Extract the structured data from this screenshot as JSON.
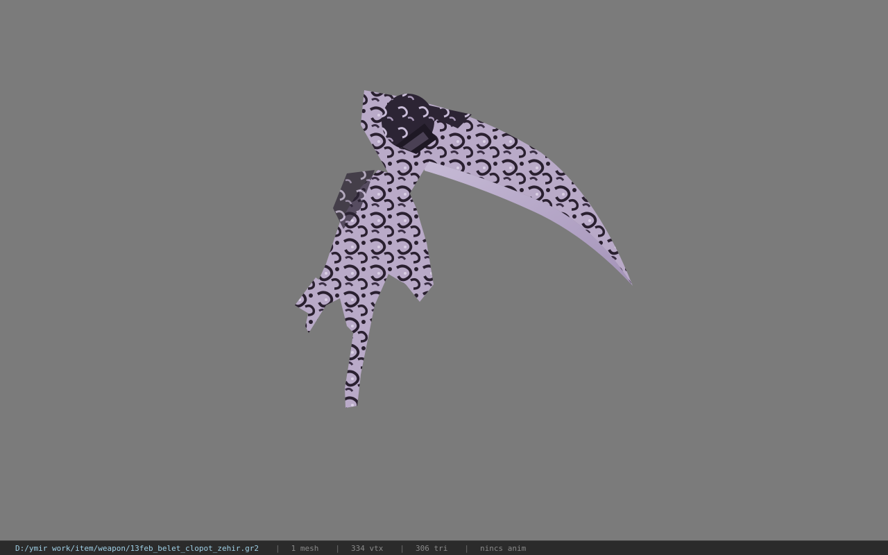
{
  "viewer": {
    "background_color": "#7b7b7b",
    "model_subject": "scythe-weapon"
  },
  "status_bar": {
    "file_path": "D:/ymir work/item/weapon/13feb_belet_clopot_zehir.gr2",
    "separator": "|",
    "mesh_count": "1 mesh",
    "vertex_count": "334 vtx",
    "triangle_count": "306 tri",
    "anim_status": "nincs anim",
    "path_color": "#9fd0e6",
    "text_color": "#8a8a8a",
    "bar_color": "#2b2b2b"
  }
}
